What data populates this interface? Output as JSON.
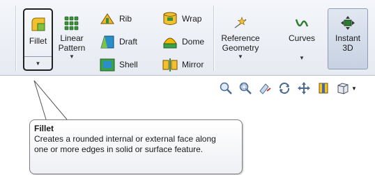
{
  "ribbon": {
    "fillet": {
      "label": "Fillet"
    },
    "linear_pattern": {
      "label_line1": "Linear",
      "label_line2": "Pattern"
    },
    "small_tools": [
      {
        "label": "Rib",
        "icon": "rib-icon"
      },
      {
        "label": "Draft",
        "icon": "draft-icon"
      },
      {
        "label": "Shell",
        "icon": "shell-icon"
      },
      {
        "label": "Wrap",
        "icon": "wrap-icon"
      },
      {
        "label": "Dome",
        "icon": "dome-icon"
      },
      {
        "label": "Mirror",
        "icon": "mirror-icon"
      }
    ],
    "reference_geometry": {
      "label_line1": "Reference",
      "label_line2": "Geometry"
    },
    "curves": {
      "label": "Curves"
    },
    "instant3d": {
      "label_line1": "Instant",
      "label_line2": "3D"
    }
  },
  "view_toolbar": {
    "icons": [
      "zoom-to-fit-icon",
      "zoom-to-area-icon",
      "previous-view-icon",
      "rotate-view-icon",
      "pan-icon",
      "section-view-icon",
      "display-style-icon"
    ]
  },
  "tooltip": {
    "title": "Fillet",
    "body": "Creates a rounded internal or external face along one or more edges in solid or surface feature."
  },
  "colors": {
    "ribbon_bg": "#eaedf3",
    "fillet_icon": "#f2c12e",
    "draft_icon": "#2a8ec9",
    "shell_icon": "#3aa34a",
    "dome_icon": "#f2b800",
    "instant_bg": "#cfd8e8"
  }
}
